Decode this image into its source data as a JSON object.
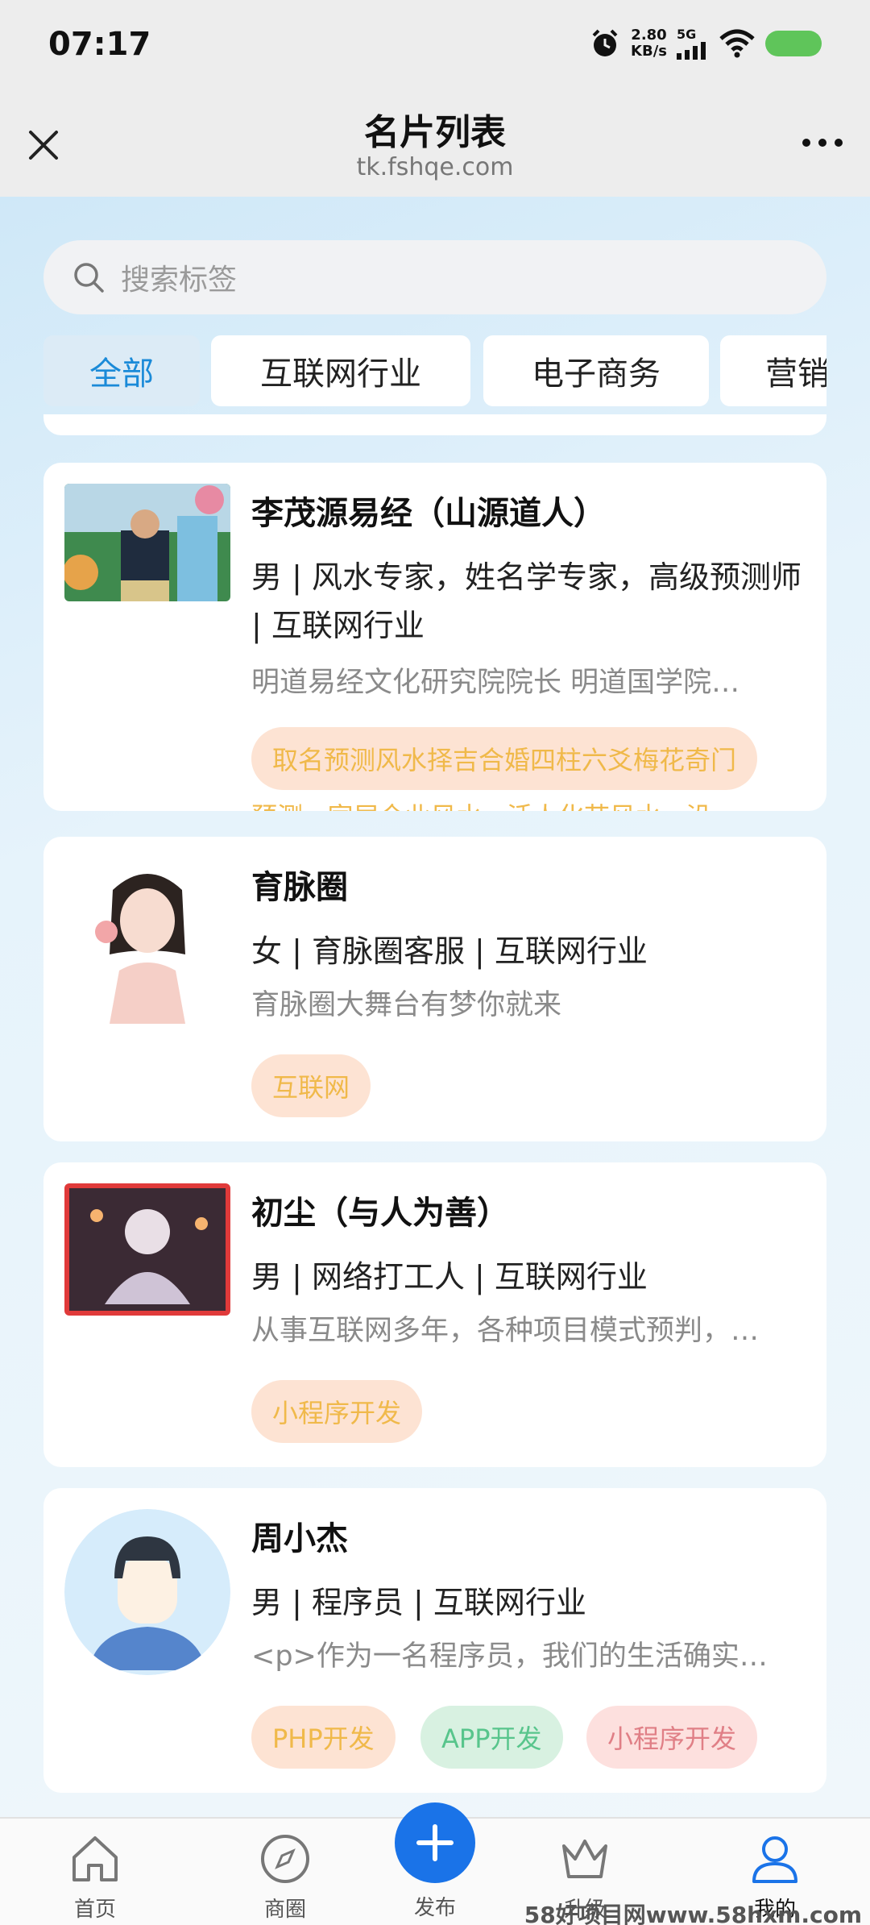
{
  "status": {
    "time": "07:17",
    "speed_value": "2.80",
    "speed_unit": "KB/s",
    "network": "5G"
  },
  "nav": {
    "title": "名片列表",
    "url": "tk.fshqe.com"
  },
  "search": {
    "placeholder": "搜索标签"
  },
  "tabs": [
    {
      "label": "全部"
    },
    {
      "label": "互联网行业"
    },
    {
      "label": "电子商务"
    },
    {
      "label": "营销"
    }
  ],
  "cards": [
    {
      "name": "李茂源易经（山源道人）",
      "meta": "男 | 风水专家，姓名学专家，高级预测师 | 互联网行业",
      "desc": "明道易经文化研究院院长 明道国学院…",
      "tags": [
        "取名预测风水择吉合婚四柱六爻梅花奇门"
      ],
      "overflow": "预测 · 家居企业风水 · 活人化苗风水 · 沿"
    },
    {
      "name": "育脉圈",
      "meta": "女 | 育脉圈客服 | 互联网行业",
      "desc": "育脉圈大舞台有梦你就来",
      "tags": [
        "互联网"
      ]
    },
    {
      "name": "初尘（与人为善）",
      "meta": "男 | 网络打工人 | 互联网行业",
      "desc": "从事互联网多年，各种项目模式预判，…",
      "tags": [
        "小程序开发"
      ]
    },
    {
      "name": "周小杰",
      "meta": "男 | 程序员 | 互联网行业",
      "desc": "<p>作为一名程序员，我们的生活确实…",
      "tags": [
        "PHP开发",
        "APP开发",
        "小程序开发"
      ]
    }
  ],
  "tabbar": {
    "home": "首页",
    "circle": "商圈",
    "publish": "发布",
    "upgrade": "升级",
    "mine": "我的"
  },
  "watermark": "58好项目网www.58hxm.com"
}
